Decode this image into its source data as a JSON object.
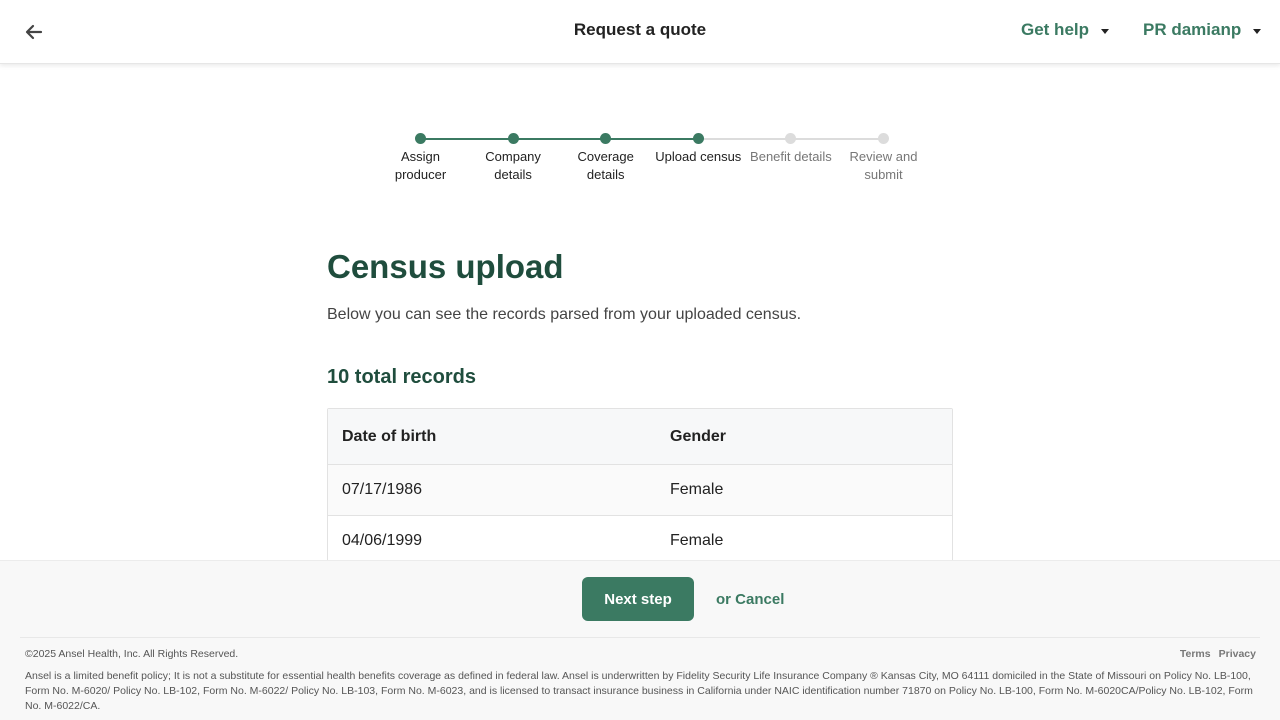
{
  "header": {
    "title": "Request a quote",
    "help_label": "Get help",
    "user_label": "PR damianp"
  },
  "stepper": {
    "steps": [
      {
        "label": "Assign producer",
        "status": "done"
      },
      {
        "label": "Company details",
        "status": "done"
      },
      {
        "label": "Coverage details",
        "status": "done"
      },
      {
        "label": "Upload census",
        "status": "done"
      },
      {
        "label": "Benefit details",
        "status": "todo"
      },
      {
        "label": "Review and submit",
        "status": "todo"
      }
    ]
  },
  "main": {
    "title": "Census upload",
    "intro": "Below you can see the records parsed from your uploaded census.",
    "records_count": "10 total records",
    "table": {
      "headers": [
        "Date of birth",
        "Gender"
      ],
      "rows": [
        [
          "07/17/1986",
          "Female"
        ],
        [
          "04/06/1999",
          "Female"
        ]
      ]
    }
  },
  "footer": {
    "next_label": "Next step",
    "cancel_label": "or Cancel",
    "copyright": "©2025 Ansel Health, Inc. All Rights Reserved.",
    "links": [
      "Terms",
      "Privacy"
    ],
    "legal": "Ansel is a limited benefit policy; It is not a substitute for essential health benefits coverage as defined in federal law. Ansel is underwritten by Fidelity Security Life Insurance Company ® Kansas City, MO 64111 domiciled in the State of Missouri on Policy No. LB-100, Form No. M-6020/ Policy No. LB-102, Form No. M-6022/ Policy No. LB-103, Form No. M-6023, and is licensed to transact insurance business in California under NAIC identification number 71870 on Policy No. LB-100, Form No. M-6020CA/Policy No. LB-102, Form No. M-6022/CA."
  },
  "colors": {
    "accent": "#3b7a62",
    "heading": "#1f4d3d",
    "inactive": "#dcdcdc"
  }
}
